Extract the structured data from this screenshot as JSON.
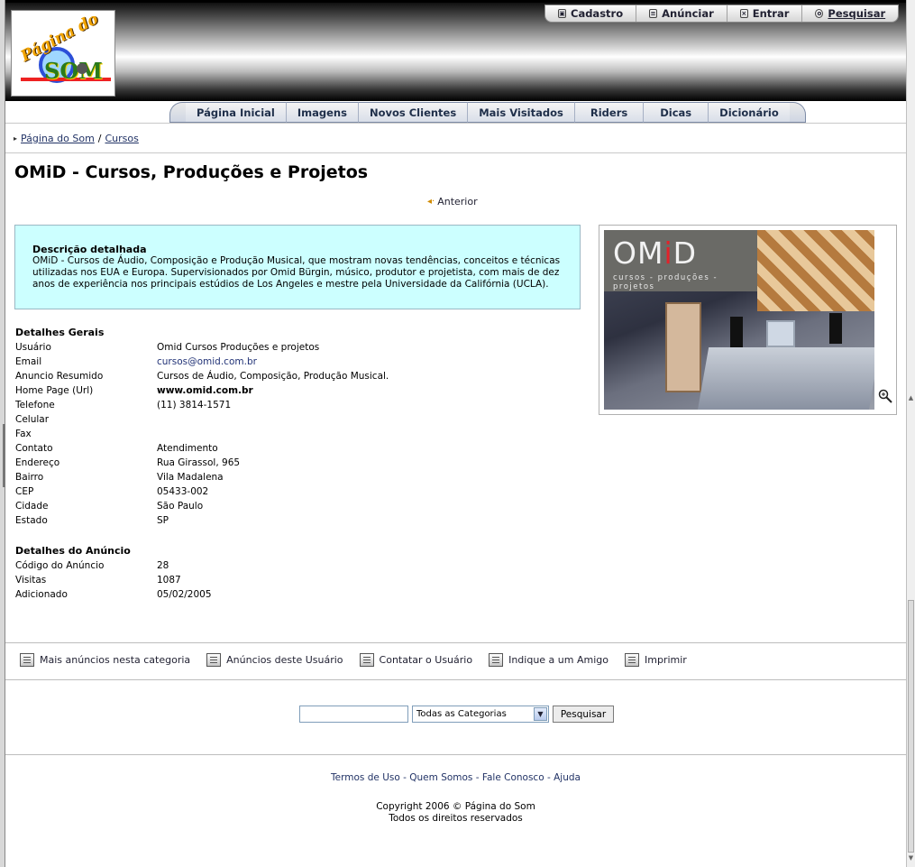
{
  "logo": {
    "line1": "Página do",
    "line2": "SOM"
  },
  "top_nav": [
    {
      "label": "Cadastro",
      "icon": "lock-icon"
    },
    {
      "label": "Anúnciar",
      "icon": "document-icon"
    },
    {
      "label": "Entrar",
      "icon": "login-icon"
    },
    {
      "label": "Pesquisar",
      "icon": "search-icon"
    }
  ],
  "main_nav": [
    "Página Inicial",
    "Imagens",
    "Novos Clientes",
    "Mais Visitados",
    "Riders",
    "Dicas",
    "Dicionário"
  ],
  "breadcrumb": {
    "home": "Página do Som",
    "separator": "/",
    "current": "Cursos"
  },
  "title": "OMiD - Cursos, Produções e Projetos",
  "prev_label": "Anterior",
  "description": {
    "heading": "Descrição detalhada",
    "text": "OMiD - Cursos de Áudio, Composição e Produção Musical, que mostram novas tendências, conceitos e técnicas utilizadas nos EUA e Europa. Supervisionados por Omid Bürgin, músico, produtor e projetista, com mais de dez anos de experiência nos principais estúdios de Los Angeles e mestre pela Universidade da Califórnia (UCLA)."
  },
  "photo": {
    "brand_o": "OM",
    "brand_i": "i",
    "brand_d": "D",
    "tagline": "cursos - produções - projetos"
  },
  "general": {
    "heading": "Detalhes Gerais",
    "rows": [
      {
        "k": "Usuário",
        "v": "Omid Cursos Produções e projetos"
      },
      {
        "k": "Email",
        "v": "cursos@omid.com.br"
      },
      {
        "k": "Anuncio Resumido",
        "v": "Cursos de Áudio, Composição, Produção Musical."
      },
      {
        "k": "Home Page (Url)",
        "v": "www.omid.com.br"
      },
      {
        "k": "Telefone",
        "v": "(11) 3814-1571"
      },
      {
        "k": "Celular",
        "v": ""
      },
      {
        "k": "Fax",
        "v": ""
      },
      {
        "k": "Contato",
        "v": "Atendimento"
      },
      {
        "k": "Endereço",
        "v": "Rua Girassol, 965"
      },
      {
        "k": "Bairro",
        "v": "Vila Madalena"
      },
      {
        "k": "CEP",
        "v": "05433-002"
      },
      {
        "k": "Cidade",
        "v": "São Paulo"
      },
      {
        "k": "Estado",
        "v": "SP"
      }
    ]
  },
  "ad": {
    "heading": "Detalhes do Anúncio",
    "rows": [
      {
        "k": "Código do Anúncio",
        "v": "28"
      },
      {
        "k": "Visitas",
        "v": "1087"
      },
      {
        "k": "Adicionado",
        "v": "05/02/2005"
      }
    ]
  },
  "actions": [
    {
      "label": "Mais anúncios nesta categoria",
      "icon": "list-icon"
    },
    {
      "label": "Anúncios deste Usuário",
      "icon": "user-ads-icon"
    },
    {
      "label": "Contatar o Usuário",
      "icon": "contact-icon"
    },
    {
      "label": "Indique a um Amigo",
      "icon": "mail-friend-icon"
    },
    {
      "label": "Imprimir",
      "icon": "printer-icon"
    }
  ],
  "search": {
    "value": "",
    "category": "Todas as Categorias",
    "button": "Pesquisar"
  },
  "footer": {
    "links": [
      "Termos de Uso",
      "Quem Somos",
      "Fale Conosco",
      "Ajuda"
    ],
    "separator": " - ",
    "copyright": "Copyright 2006 © Página do Som",
    "rights": "Todos os direitos reservados"
  }
}
